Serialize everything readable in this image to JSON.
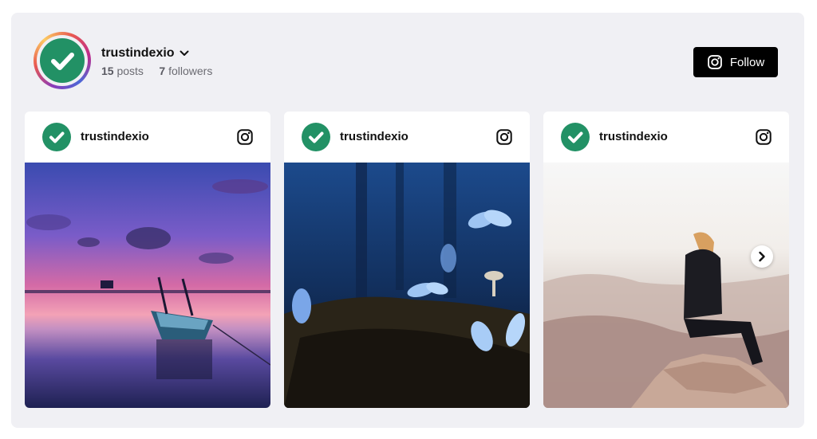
{
  "profile": {
    "username": "trustindexio",
    "posts_count": "15",
    "posts_label": "posts",
    "followers_count": "7",
    "followers_label": "followers",
    "avatar_color": "#229165"
  },
  "follow_button": {
    "label": "Follow",
    "icon": "instagram-icon"
  },
  "posts": [
    {
      "username": "trustindexio",
      "photo": "sunset over calm water with a small moored boat",
      "icon": "instagram-icon"
    },
    {
      "username": "trustindexio",
      "photo": "blue butterflies over mossy ground with small mushrooms",
      "icon": "instagram-icon"
    },
    {
      "username": "trustindexio",
      "photo": "person sitting on a rock overlooking misty mountains",
      "icon": "instagram-icon"
    }
  ],
  "carousel": {
    "next_icon": "chevron-right-icon"
  }
}
